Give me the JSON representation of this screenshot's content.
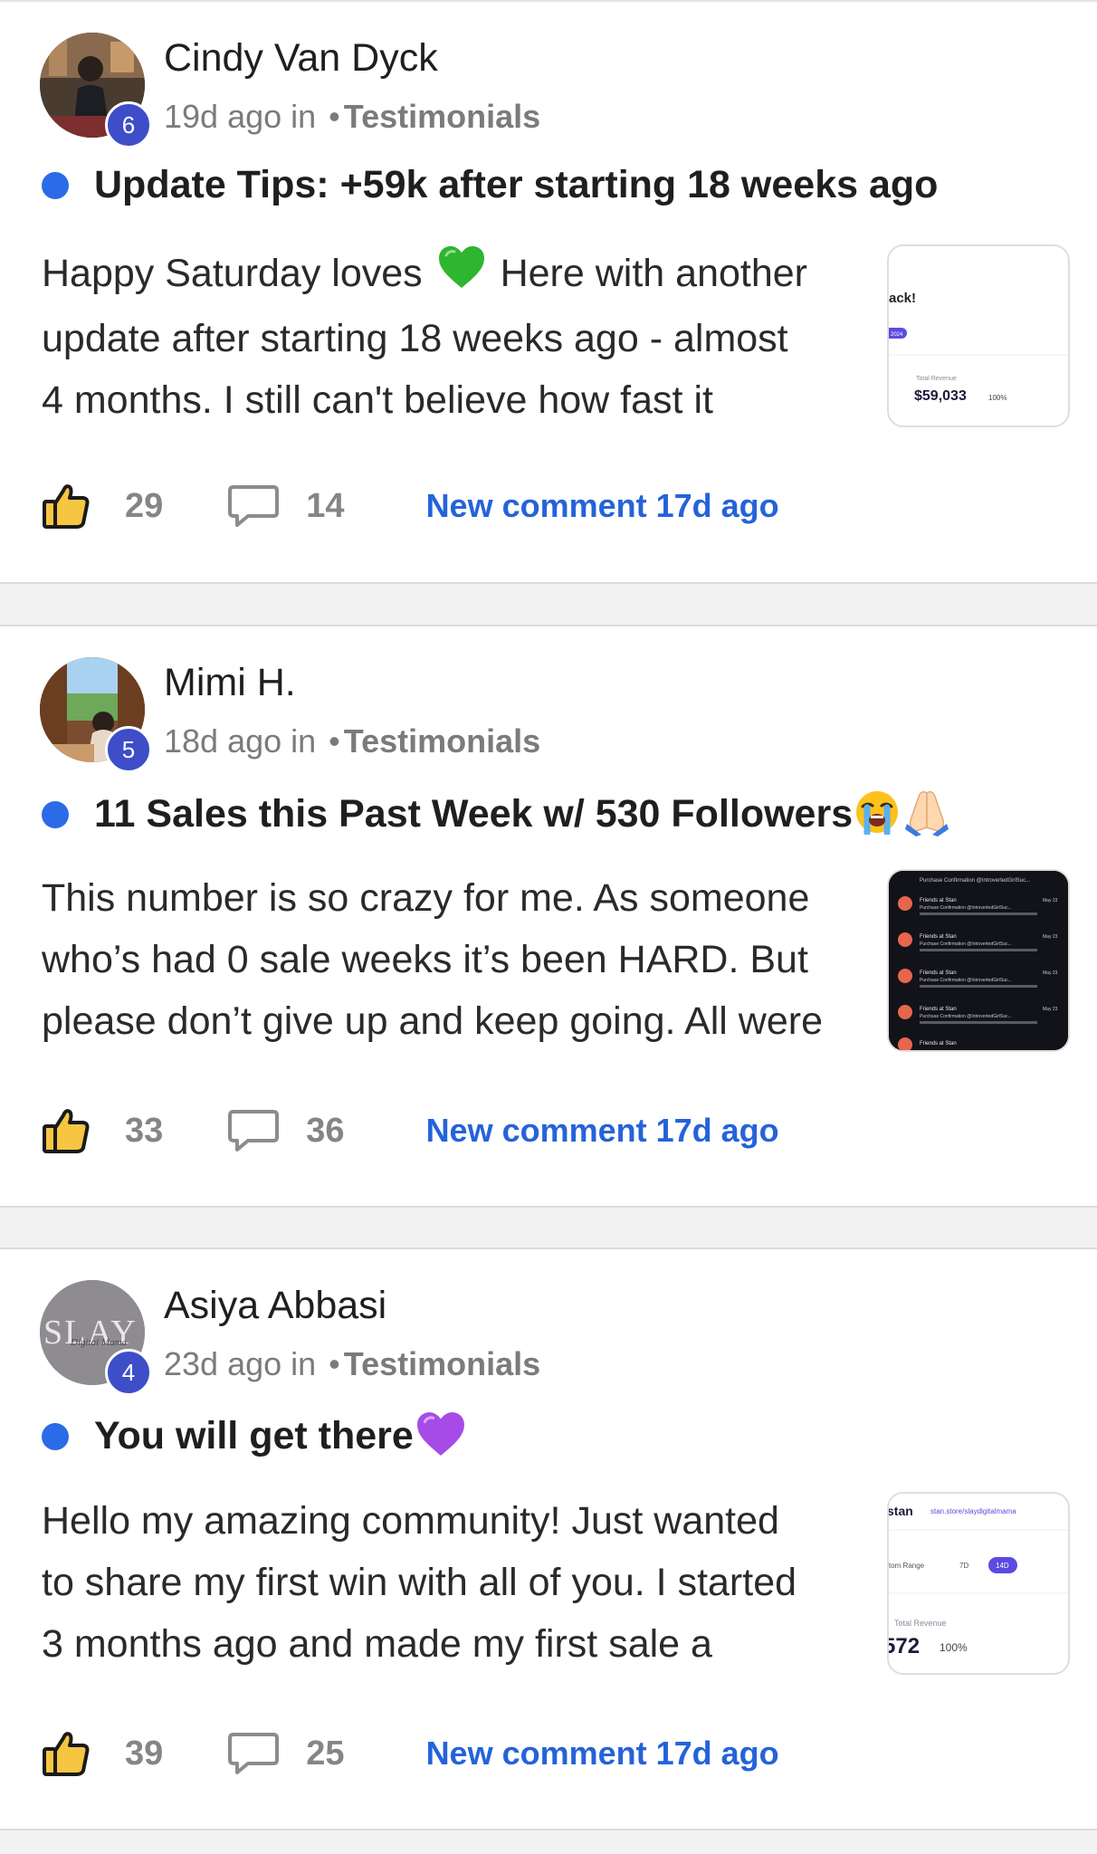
{
  "posts": [
    {
      "author": "Cindy Van Dyck",
      "level": "6",
      "time": "19d ago in",
      "category": "Testimonials",
      "title": "Update Tips: +59k after starting 18 weeks ago",
      "body_lines": [
        "Happy Saturday loves",
        "Here with another",
        "update after starting 18 weeks ago - almost",
        "4 months. I still can't believe how fast it"
      ],
      "likes": "29",
      "comments": "14",
      "new_comment": "New comment 17d ago",
      "thumbnail": {
        "kind": "revenue-card",
        "header": "ack!",
        "badge": "2024",
        "label": "Total Revenue",
        "value": "$59,033",
        "percent": "100%"
      }
    },
    {
      "author": "Mimi H.",
      "level": "5",
      "time": "18d ago in",
      "category": "Testimonials",
      "title": "11 Sales this Past Week w/ 530 Followers",
      "body_lines": [
        "This number is so crazy for me. As someone",
        "who’s had 0 sale weeks it’s been HARD. But",
        "please don’t give up and keep going. All were"
      ],
      "likes": "33",
      "comments": "36",
      "new_comment": "New comment 17d ago",
      "thumbnail": {
        "kind": "notification-list",
        "sender": "Friends at Stan",
        "line": "Purchase Confirmation @IntrovertedGirlSuc...",
        "date": "May 23"
      }
    },
    {
      "author": "Asiya Abbasi",
      "level": "4",
      "time": "23d ago in",
      "category": "Testimonials",
      "title": "You will get there",
      "body_lines": [
        "Hello my amazing community! Just wanted",
        "to share my first win with all of you. I started",
        "3 months ago and made my first sale a"
      ],
      "likes": "39",
      "comments": "25",
      "new_comment": "New comment 17d ago",
      "thumbnail": {
        "kind": "stan-store",
        "brand": "stan",
        "url": "stan.store/slaydigitalmama",
        "range_label": "tom Range",
        "range_7d": "7D",
        "range_14d": "14D",
        "label": "Total Revenue",
        "value": "572",
        "percent": "100%"
      }
    }
  ],
  "colors": {
    "accent_blue": "#2563d9",
    "bullet_blue": "#2c6be7",
    "level_badge": "#3d4ec8",
    "muted": "#7b7b7b"
  },
  "icons": {
    "like": "thumbs-up-icon",
    "comment": "speech-bubble-icon",
    "heart_green": "green-heart-emoji",
    "heart_purple": "purple-heart-emoji",
    "crying": "loudly-crying-face-emoji",
    "pray": "folded-hands-emoji"
  }
}
